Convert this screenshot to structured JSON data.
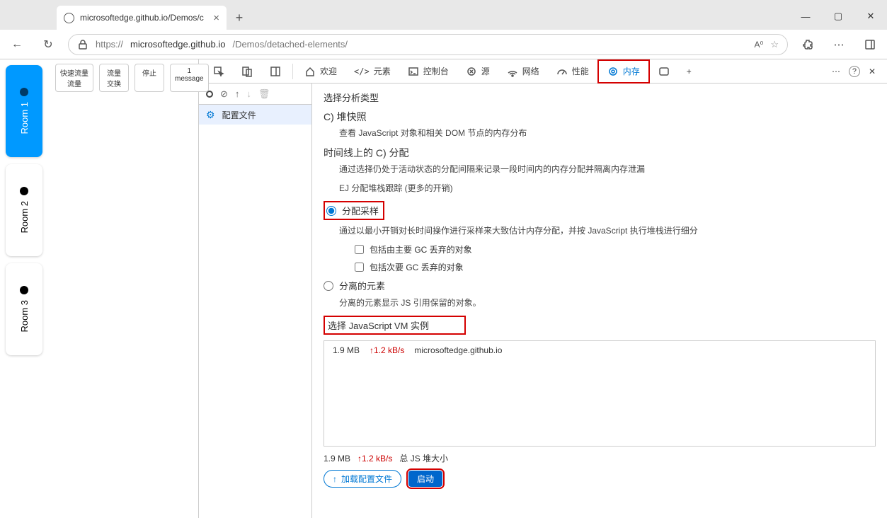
{
  "browser_tab": {
    "title": "microsoftedge.github.io/Demos/c"
  },
  "url": {
    "protocol": "https://",
    "host": "microsoftedge.github.io",
    "path": "/Demos/detached-elements/"
  },
  "rooms": [
    {
      "label": "Room 1",
      "active": true
    },
    {
      "label": "Room 2",
      "active": false
    },
    {
      "label": "Room 3",
      "active": false
    }
  ],
  "app_buttons": [
    {
      "line1": "快速流量",
      "line2": "流量"
    },
    {
      "line1": "流量",
      "line2": "交换"
    },
    {
      "line1": "停止",
      "line2": ""
    },
    {
      "line1": "1",
      "line2": "message"
    }
  ],
  "devtools": {
    "tabs": {
      "welcome": "欢迎",
      "elements": "元素",
      "console": "控制台",
      "sources": "源",
      "network": "网络",
      "performance": "性能",
      "memory": "内存"
    },
    "profiles_label": "配置文件",
    "panel": {
      "heading": "选择分析类型",
      "opt_heap_title": "C) 堆快照",
      "opt_heap_desc": "查看 JavaScript 对象和相关 DOM 节点的内存分布",
      "opt_timeline_title": "时间线上的 C) 分配",
      "opt_timeline_desc": "通过选择仍处于活动状态的分配间隔来记录一段时间内的内存分配并隔离内存泄漏",
      "opt_timeline_sub": "EJ 分配堆栈跟踪 (更多的开销)",
      "opt_sampling_title": "分配采样",
      "opt_sampling_desc": "通过以最小开销对长时间操作进行采样来大致估计内存分配，并按 JavaScript 执行堆栈进行细分",
      "checkbox_major": "包括由主要 GC 丢弃的对象",
      "checkbox_minor": "包括次要 GC 丢弃的对象",
      "opt_detached_title": "分离的元素",
      "opt_detached_desc": "分离的元素显示 JS 引用保留的对象。",
      "vm_section": "选择 JavaScript VM 实例",
      "vm_size": "1.9 MB",
      "vm_rate": "↑1.2 kB/s",
      "vm_host": "microsoftedge.github.io",
      "total_size": "1.9 MB",
      "total_rate": "↑1.2 kB/s",
      "total_label": "总 JS 堆大小",
      "load_button": "加载配置文件",
      "start_button": "启动"
    }
  }
}
